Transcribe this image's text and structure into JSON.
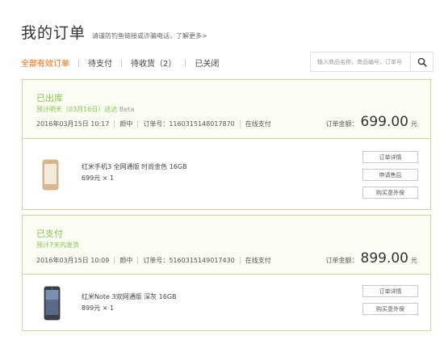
{
  "header": {
    "title": "我的订单",
    "notice": "请谨防钓鱼链接或诈骗电话，",
    "notice_link": "了解更多>"
  },
  "tabs": [
    {
      "label": "全部有效订单",
      "active": true
    },
    {
      "label": "待支付"
    },
    {
      "label": "待收货（2）"
    },
    {
      "label": "已关闭"
    }
  ],
  "search": {
    "placeholder": "输入商品名称，商品编号，订单号",
    "icon": "search-icon"
  },
  "orders": [
    {
      "status": "已出库",
      "eta": "预计明天（03月16日）送达",
      "eta_tag": "Beta",
      "datetime": "2016年03月15日 10:17",
      "name": "颜中",
      "order_no": "订单号：1160315148017870",
      "payment": "在线支付",
      "total_label": "订单金额：",
      "total_amount": "699.00",
      "total_unit": "元",
      "product": {
        "name": "红米手机3 全网通版 时尚金色 16GB",
        "price": "699元 × 1",
        "image_color": "#d9b88f"
      },
      "actions": [
        "订单详情",
        "申请售后",
        "购买意外保"
      ]
    },
    {
      "status": "已支付",
      "eta": "预计7天内发货",
      "datetime": "2016年03月15日 10:09",
      "name": "颜中",
      "order_no": "订单号：5160315149017430",
      "payment": "在线支付",
      "total_label": "订单金额：",
      "total_amount": "899.00",
      "total_unit": "元",
      "product": {
        "name": "红米Note 3双网通版 深灰 16GB",
        "price": "899元 × 1",
        "image_color": "#3a3f48"
      },
      "actions": [
        "订单详情",
        "购买意外保"
      ]
    }
  ],
  "colors": {
    "accent": "#ff6700",
    "status_green": "#83c44e",
    "border_green": "#c8d6a0"
  }
}
